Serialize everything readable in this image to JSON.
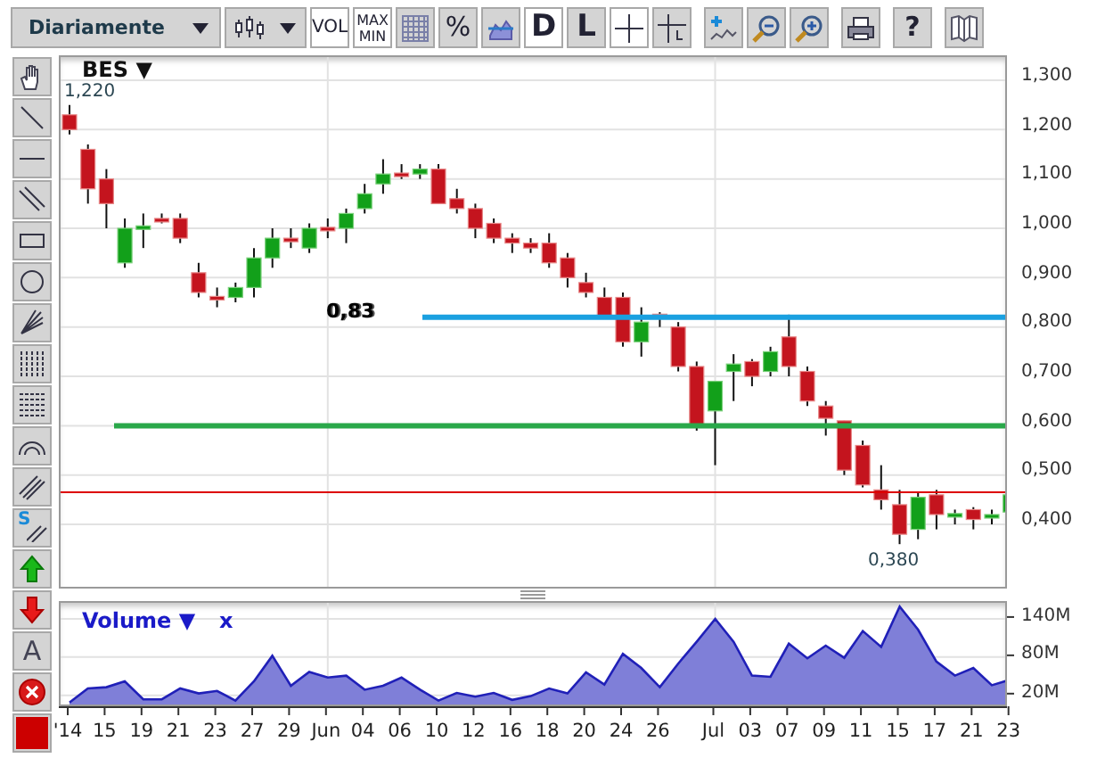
{
  "toolbar": [
    [
      {
        "kind": "dropdown",
        "label": "Diariamente"
      },
      {
        "kind": "chart-type"
      },
      {
        "kind": "text",
        "label": "VOL",
        "selected": true
      },
      {
        "kind": "stack",
        "lines": [
          "MAX",
          "MIN"
        ],
        "selected": true
      },
      {
        "kind": "grid",
        "selected": false
      },
      {
        "kind": "text",
        "label": "%",
        "selected": false
      },
      {
        "kind": "area",
        "selected": false
      },
      {
        "kind": "big",
        "label": "D",
        "selected": true
      },
      {
        "kind": "big",
        "label": "L",
        "selected": false
      },
      {
        "kind": "crosshair",
        "selected": true
      },
      {
        "kind": "crosshair-l",
        "selected": false
      }
    ],
    [
      {
        "kind": "add-indicator",
        "selected": false
      },
      {
        "kind": "zoom-out",
        "selected": false
      },
      {
        "kind": "zoom-in",
        "selected": false
      }
    ],
    [
      {
        "kind": "print",
        "selected": false
      }
    ],
    [
      {
        "kind": "help",
        "label": "?",
        "selected": false
      }
    ],
    [
      {
        "kind": "book",
        "selected": false
      }
    ]
  ],
  "tools": [
    {
      "kind": "hand"
    },
    {
      "kind": "line"
    },
    {
      "kind": "hline"
    },
    {
      "kind": "parallel"
    },
    {
      "kind": "rect"
    },
    {
      "kind": "circle"
    },
    {
      "kind": "fan"
    },
    {
      "kind": "vlines"
    },
    {
      "kind": "hlines"
    },
    {
      "kind": "arc"
    },
    {
      "kind": "channel"
    },
    {
      "kind": "dollar-channel",
      "label": "S"
    },
    {
      "kind": "up-arrow"
    },
    {
      "kind": "down-arrow"
    },
    {
      "kind": "text",
      "label": "A"
    },
    {
      "kind": "delete"
    },
    {
      "kind": "color",
      "color": "#cc0000"
    }
  ],
  "price_chart": {
    "symbol": "BES",
    "menu": "▼",
    "max_label": "1,220",
    "min_label": "0,380",
    "annotation": "0,83",
    "y_labels": [
      "1,300",
      "1,200",
      "1,100",
      "1,000",
      "0,900",
      "0,800",
      "0,700",
      "0,600",
      "0,500",
      "0,400"
    ]
  },
  "volume_panel": {
    "title": "Volume",
    "menu": "▼",
    "close": "x",
    "chart_data": {
      "type": "area",
      "ylim": [
        3,
        165
      ],
      "values": [
        9,
        31,
        33,
        42,
        14,
        14,
        31,
        23,
        27,
        12,
        42,
        82,
        35,
        57,
        48,
        51,
        29,
        35,
        48,
        29,
        12,
        24,
        18,
        24,
        13,
        19,
        31,
        23,
        56,
        37,
        85,
        63,
        33,
        70,
        104,
        140,
        104,
        51,
        49,
        101,
        78,
        98,
        79,
        121,
        96,
        159,
        123,
        73,
        51,
        63,
        36,
        45
      ],
      "yticks": [
        {
          "value": 20,
          "label": "20M"
        },
        {
          "value": 80,
          "label": "80M"
        },
        {
          "value": 140,
          "label": "140M"
        }
      ],
      "grid": true,
      "categories": [
        "'14",
        null,
        "15",
        null,
        "19",
        null,
        "21",
        null,
        "23",
        null,
        "27",
        null,
        "29",
        null,
        "Jun",
        null,
        "04",
        null,
        "06",
        null,
        "10",
        null,
        "12",
        null,
        "16",
        null,
        "18",
        null,
        "20",
        null,
        "24",
        null,
        "26",
        null,
        null,
        "Jul",
        null,
        "03",
        null,
        "07",
        null,
        "09",
        null,
        "11",
        null,
        "15",
        null,
        "17",
        null,
        "21",
        null,
        "23"
      ]
    }
  }
}
